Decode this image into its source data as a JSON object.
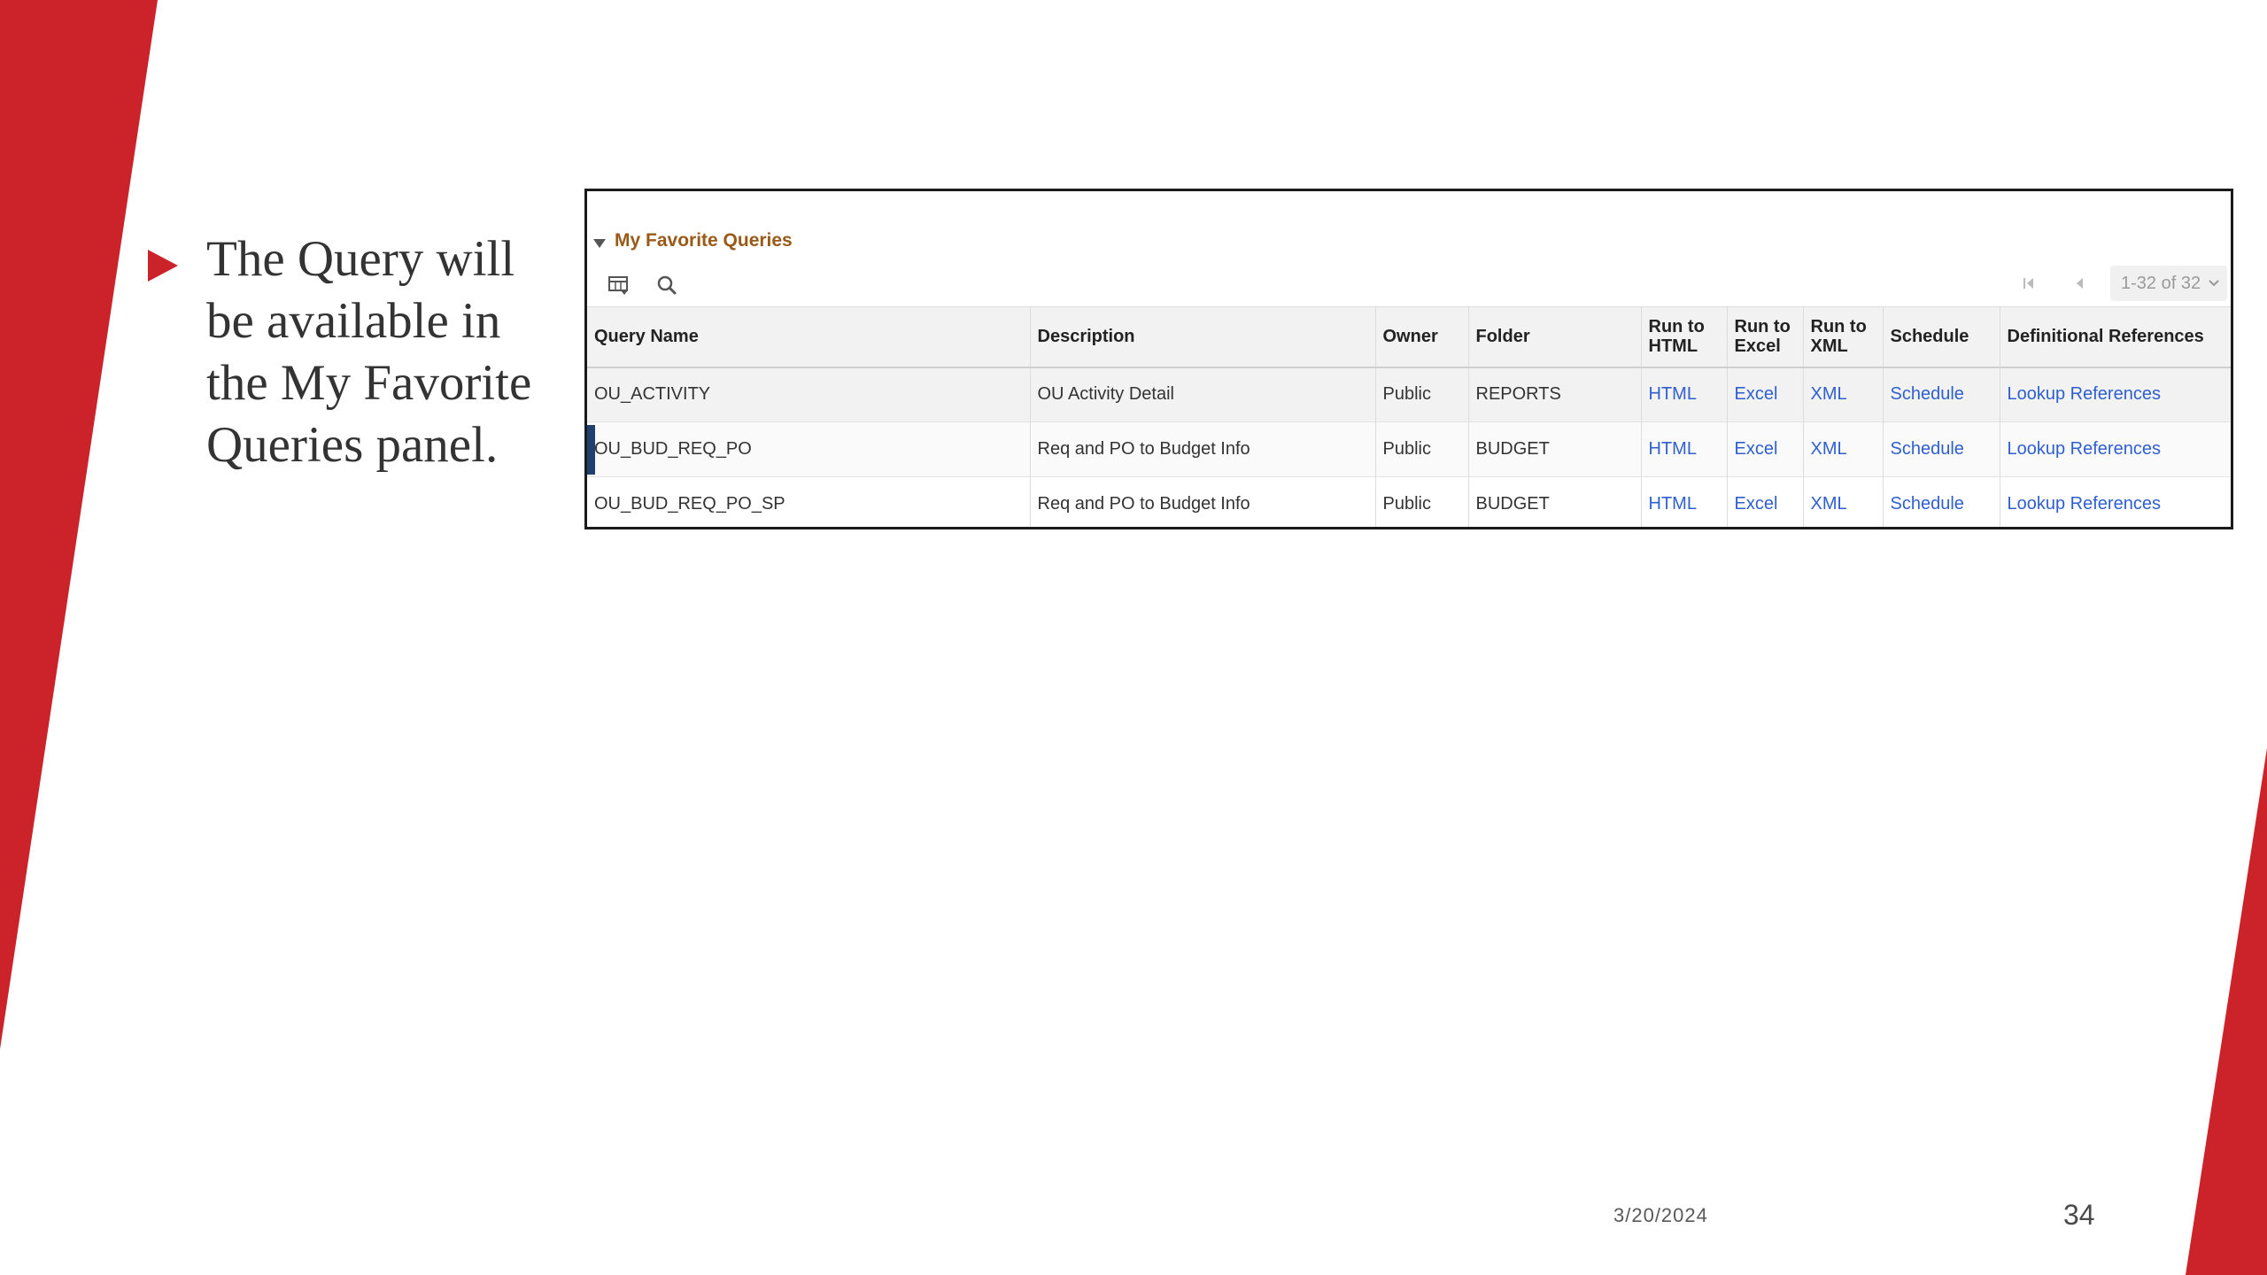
{
  "slide": {
    "bullet_text": "The Query will be available in the My Favorite Queries panel.",
    "date": "3/20/2024",
    "page_number": "34"
  },
  "colors": {
    "accent_red": "#cc2229",
    "panel_title": "#9a5a17",
    "link": "#2f5fcf"
  },
  "panel": {
    "title": "My Favorite Queries",
    "icons": {
      "collapse": "triangle-down-icon",
      "grid_settings": "grid-settings-icon",
      "search": "search-icon",
      "first_page": "first-page-icon",
      "previous_page": "previous-page-icon"
    },
    "pager": {
      "label": "1-32 of 32"
    },
    "columns": [
      "Query Name",
      "Description",
      "Owner",
      "Folder",
      "Run to HTML",
      "Run to Excel",
      "Run to XML",
      "Schedule",
      "Definitional References"
    ],
    "rows": [
      {
        "query_name": "OU_ACTIVITY",
        "description": "OU Activity Detail",
        "owner": "Public",
        "folder": "REPORTS",
        "html": "HTML",
        "excel": "Excel",
        "xml": "XML",
        "schedule": "Schedule",
        "references": "Lookup References"
      },
      {
        "query_name": "OU_BUD_REQ_PO",
        "description": "Req and PO to Budget Info",
        "owner": "Public",
        "folder": "BUDGET",
        "html": "HTML",
        "excel": "Excel",
        "xml": "XML",
        "schedule": "Schedule",
        "references": "Lookup References"
      },
      {
        "query_name": "OU_BUD_REQ_PO_SP",
        "description": "Req and PO to Budget Info",
        "owner": "Public",
        "folder": "BUDGET",
        "html": "HTML",
        "excel": "Excel",
        "xml": "XML",
        "schedule": "Schedule",
        "references": "Lookup References"
      }
    ]
  }
}
